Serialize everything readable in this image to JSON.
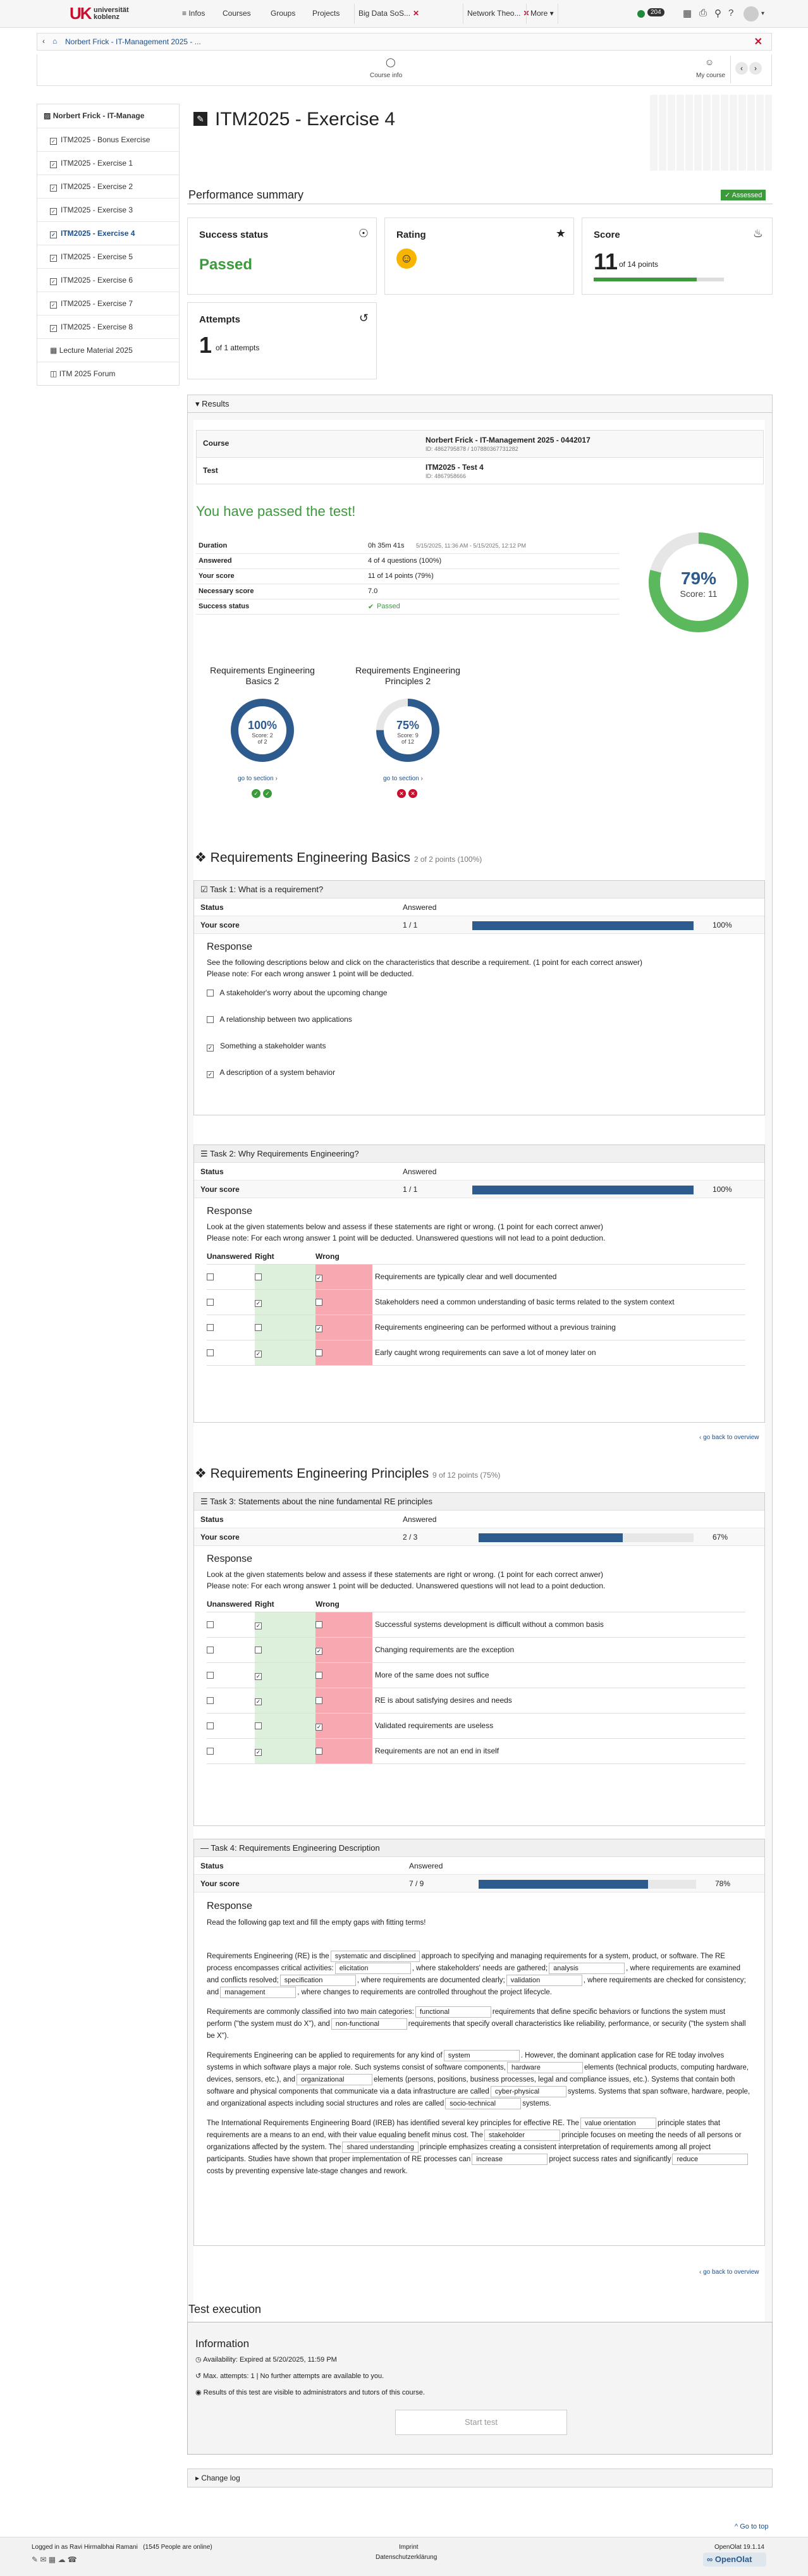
{
  "topbar": {
    "logo": "UK",
    "logo_lines": [
      "universität",
      "koblenz"
    ],
    "items": [
      "Infos",
      "Courses",
      "Groups",
      "Projects"
    ],
    "tabs": [
      {
        "label": "Big Data SoS..."
      },
      {
        "label": "Network Theo..."
      },
      {
        "label": "More"
      }
    ],
    "badge": "204"
  },
  "subbar": {
    "back": "Norbert Frick - IT-Management 2025 - ..."
  },
  "toolbar": {
    "course_info": "Course info",
    "my_course": "My course"
  },
  "menu": {
    "title": "Norbert Frick - IT-Manage",
    "items": [
      {
        "label": "ITM2025 - Bonus Exercise",
        "active": false
      },
      {
        "label": "ITM2025 - Exercise 1",
        "active": false
      },
      {
        "label": "ITM2025 - Exercise 2",
        "active": false
      },
      {
        "label": "ITM2025 - Exercise 3",
        "active": false
      },
      {
        "label": "ITM2025 - Exercise 4",
        "active": true
      },
      {
        "label": "ITM2025 - Exercise 5",
        "active": false
      },
      {
        "label": "ITM2025 - Exercise 6",
        "active": false
      },
      {
        "label": "ITM2025 - Exercise 7",
        "active": false
      },
      {
        "label": "ITM2025 - Exercise 8",
        "active": false
      },
      {
        "label": "Lecture Material 2025",
        "active": false
      },
      {
        "label": "ITM 2025 Forum",
        "active": false
      }
    ]
  },
  "page": {
    "title": "ITM2025 - Exercise 4"
  },
  "summary": {
    "heading": "Performance summary",
    "badge": "Assessed",
    "status_title": "Success status",
    "status_value": "Passed",
    "rating_title": "Rating",
    "score_title": "Score",
    "score_value": "11",
    "score_sub": "of 14 points",
    "score_fraction": 0.79,
    "attempts_title": "Attempts",
    "attempts_value": "1",
    "attempts_sub": "of 1 attempts"
  },
  "results": {
    "toggle": "Results",
    "course_label": "Course",
    "course_value": "Norbert Frick - IT-Management 2025 - 0442017",
    "course_id": "ID: 4862795878 / 107880367731282",
    "test_label": "Test",
    "test_value": "ITM2025 - Test 4",
    "test_id": "ID: 4867958666",
    "passed_msg": "You have passed the test!",
    "rows": [
      {
        "label": "Duration",
        "value": "0h 35m 41s",
        "extra": "5/15/2025, 11:36 AM - 5/15/2025, 12:12 PM"
      },
      {
        "label": "Answered",
        "value": "4 of 4 questions (100%)",
        "extra": ""
      },
      {
        "label": "Your score",
        "value": "11 of 14 points (79%)",
        "extra": ""
      },
      {
        "label": "Necessary score",
        "value": "7.0",
        "extra": ""
      },
      {
        "label": "Success status",
        "value": "Passed",
        "extra": ""
      }
    ],
    "big_pct": "79%",
    "big_score": "Score: 11",
    "big_fraction": 0.79,
    "sections": [
      {
        "title": "Requirements Engineering Basics 2",
        "pct": "100%",
        "score": "Score: 2",
        "of": "of 2",
        "fraction": 1.0,
        "link": "go to section"
      },
      {
        "title": "Requirements Engineering Principles 2",
        "pct": "75%",
        "score": "Score: 9",
        "of": "of 12",
        "fraction": 0.75,
        "link": "go to section"
      }
    ]
  },
  "basics": {
    "title": "Requirements Engineering Basics",
    "sub": "2 of 2 points (100%)"
  },
  "principles": {
    "title": "Requirements Engineering Principles",
    "sub": "9 of 12 points (75%)"
  },
  "labels": {
    "status": "Status",
    "answered": "Answered",
    "your_score": "Your score",
    "response": "Response",
    "unanswered": "Unanswered",
    "right": "Right",
    "wrong": "Wrong",
    "back": "go back to overview"
  },
  "task1": {
    "title": "Task 1: What is a requirement?",
    "score": "1 / 1",
    "pct": "100%",
    "fraction": 1.0,
    "instr": "See the following descriptions below and click on the characteristics that describe a requirement. (1 point for each correct answer)",
    "note": "Please note: For each wrong answer 1 point will be deducted.",
    "options": [
      {
        "label": "A stakeholder's worry about the upcoming change",
        "checked": false
      },
      {
        "label": "A relationship between two applications",
        "checked": false
      },
      {
        "label": "Something a stakeholder wants",
        "checked": true
      },
      {
        "label": "A description of a system behavior",
        "checked": true
      }
    ]
  },
  "task2": {
    "title": "Task 2: Why Requirements Engineering?",
    "score": "1 / 1",
    "pct": "100%",
    "fraction": 1.0,
    "instr": "Look at the given statements below and assess if these statements are right or wrong. (1 point for each correct anwer)",
    "note": "Please note: For each wrong answer 1 point will be deducted. Unanswered questions will not lead to a point deduction.",
    "rows": [
      {
        "label": "Requirements are typically clear and well documented",
        "answer": "wrong"
      },
      {
        "label": "Stakeholders need a common understanding of basic terms related to the system context",
        "answer": "right"
      },
      {
        "label": "Requirements engineering can be performed without a previous training",
        "answer": "wrong"
      },
      {
        "label": "Early caught wrong requirements can save a lot of money later on",
        "answer": "right"
      }
    ]
  },
  "task3": {
    "title": "Task 3: Statements about the nine fundamental RE principles",
    "score": "2 / 3",
    "pct": "67%",
    "fraction": 0.67,
    "instr": "Look at the given statements below and assess if these statements are right or wrong. (1 point for each correct anwer)",
    "note": "Please note: For each wrong answer 1 point will be deducted. Unanswered questions will not lead to a point deduction.",
    "rows": [
      {
        "label": "Successful systems development is difficult without a common basis",
        "answer": "right"
      },
      {
        "label": "Changing requirements are the exception",
        "answer": "wrong"
      },
      {
        "label": "More of the same does not suffice",
        "answer": "right"
      },
      {
        "label": "RE is about satisfying desires and needs",
        "answer": "right"
      },
      {
        "label": "Validated requirements are useless",
        "answer": "wrong"
      },
      {
        "label": "Requirements are not an end in itself",
        "answer": "right"
      }
    ]
  },
  "task4": {
    "title": "Task 4: Requirements Engineering Description",
    "score": "7 / 9",
    "pct": "78%",
    "fraction": 0.78,
    "instr": "Read the following gap text and fill the empty gaps with fitting terms!",
    "gaps": [
      "systematic and disciplined",
      "elicitation",
      "analysis",
      "specification",
      "validation",
      "management",
      "functional",
      "non-functional",
      "system",
      "hardware",
      "organizational",
      "cyber-physical",
      "socio-technical",
      "value orientation",
      "stakeholder",
      "shared understanding",
      "increase",
      "reduce"
    ],
    "p1": [
      "Requirements Engineering (RE) is the",
      "approach to specifying and managing requirements for a system, product, or software. The RE process encompasses critical activities:",
      ", where stakeholders' needs are gathered;",
      ",",
      "where requirements are examined and conflicts resolved;",
      ", where requirements are documented clearly;",
      ", where requirements are checked for consistency; and",
      ", where changes to requirements are controlled throughout the project lifecycle."
    ],
    "p2": [
      "Requirements are commonly classified into two main categories:",
      "requirements that define specific behaviors or functions the system must perform (\"the system must do X\"), and",
      "requirements that specify overall characteristics like reliability, performance, or security (\"the system shall be X\")."
    ],
    "p3": [
      "Requirements Engineering can be applied to requirements for any kind of",
      ". However, the dominant application case for RE today involves systems in which software plays a major role. Such systems consist of software components,",
      "elements (technical products, computing hardware, devices, sensors, etc.), and",
      "elements (persons, positions, business processes, legal and compliance issues, etc.). Systems that contain both software and physical components that communicate via a data infrastructure are called",
      "systems. Systems that span software, hardware, people, and organizational aspects including social structures and roles are called",
      "systems."
    ],
    "p4": [
      "The International Requirements Engineering Board (IREB) has identified several key principles for effective RE. The",
      "principle states that requirements are a means to an end, with their value equaling benefit minus cost. The",
      "principle focuses on meeting the needs of all persons or organizations affected by the system. The",
      "principle emphasizes creating a consistent interpretation of requirements among all project participants. Studies have shown that proper implementation of RE processes can",
      "project success rates and significantly",
      "costs by preventing expensive late-stage changes and rework."
    ]
  },
  "execution": {
    "heading": "Test execution",
    "info": "Information",
    "availability": "Availability: Expired at 5/20/2025, 11:59 PM",
    "max": "Max. attempts: 1 | No further attempts are available to you.",
    "visibility": "Results of this test are visible to administrators and tutors of this course.",
    "start": "Start test"
  },
  "changelog": "Change log",
  "goto_top": "Go to top",
  "footer": {
    "logged": "Logged in as Ravi Hirmalbhai Ramani",
    "online": "(1545 People are online)",
    "imprint": "Imprint",
    "privacy": "Datenschutzerklärung",
    "version": "OpenOlat 19.1.14",
    "brand": "OpenOlat"
  },
  "colors": {
    "accent": "#2e5b8e",
    "green": "#3c9a3c",
    "red": "#c8102e",
    "gray_bg": "#f6f6f6"
  }
}
